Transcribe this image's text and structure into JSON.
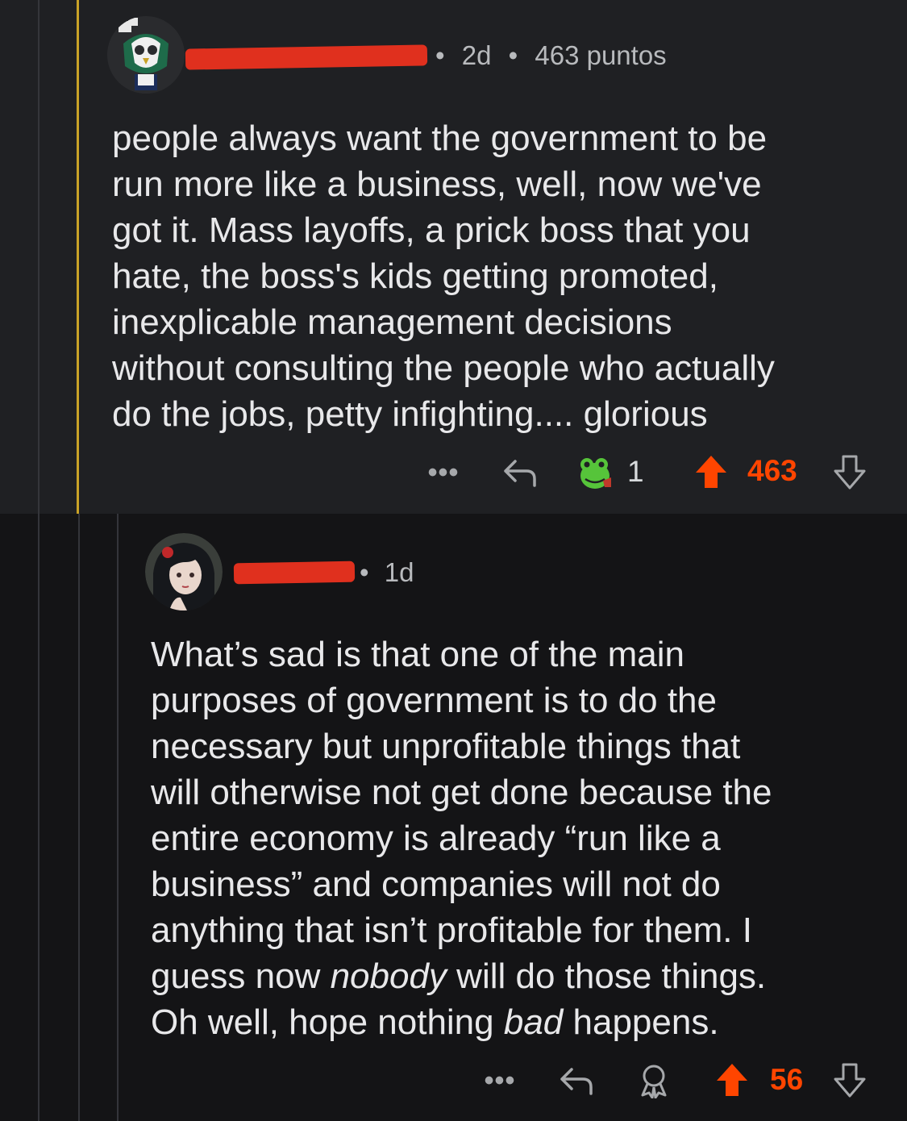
{
  "comment1": {
    "time": "2d",
    "points": "463 puntos",
    "body": "people always want the government to be\nrun more like a business, well, now we've\ngot it. Mass layoffs, a prick boss that you\nhate, the boss's kids getting promoted,\ninexplicable management decisions\nwithout consulting the people who actually\ndo the jobs, petty infighting.... glorious",
    "award_count": "1",
    "score": "463"
  },
  "comment2": {
    "time": "1d",
    "body_part1": "What’s sad is that one of the main\npurposes of government is to do the\nnecessary but unprofitable things that\nwill otherwise not get done because the\nentire economy is already “run like a\nbusiness” and companies will not do\nanything that isn’t profitable for them. I\nguess now ",
    "body_em1": "nobody",
    "body_part2": " will do those things.\nOh well, hope nothing ",
    "body_em2": "bad",
    "body_part3": " happens.",
    "score": "56"
  },
  "colors": {
    "upvote": "#ff4500",
    "thread_gold": "#c9a227",
    "background": "#141416",
    "comment_highlight_bg": "#1f2023"
  },
  "icons": [
    "more-icon",
    "reply-icon",
    "award-icon",
    "upvote-icon",
    "downvote-icon"
  ],
  "separator": "•"
}
